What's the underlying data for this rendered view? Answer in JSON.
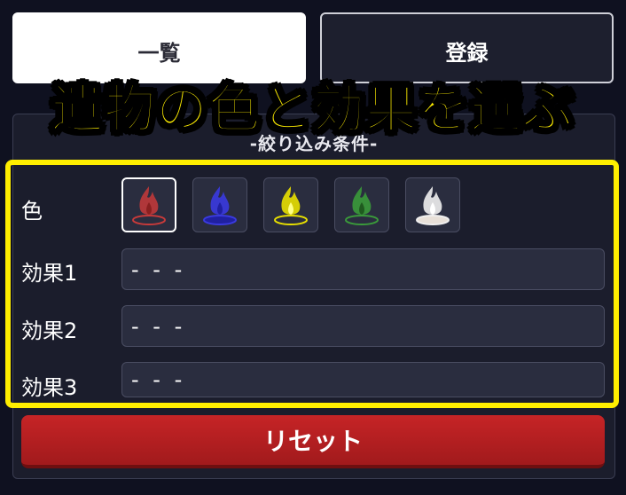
{
  "tabs": {
    "list_label": "一覧",
    "register_label": "登録"
  },
  "banner": {
    "text": "遺物の色と効果を選ぶ"
  },
  "filter": {
    "title": "-絞り込み条件-",
    "color_label": "色",
    "colors": [
      {
        "name": "red",
        "hex": "#c83a3a",
        "selected": true
      },
      {
        "name": "blue",
        "hex": "#3a3ae0",
        "selected": false
      },
      {
        "name": "yellow",
        "hex": "#e8e000",
        "selected": false
      },
      {
        "name": "green",
        "hex": "#3a9a3a",
        "selected": false
      },
      {
        "name": "white",
        "hex": "#f0f0f0",
        "selected": false
      }
    ],
    "effects": [
      {
        "label": "効果1",
        "value": "- - -"
      },
      {
        "label": "効果2",
        "value": "- - -"
      },
      {
        "label": "効果3",
        "value": "- - -"
      }
    ]
  },
  "reset_label": "リセット",
  "icons": [
    "flame-icon"
  ],
  "accent_colors": {
    "highlight": "#ffee00",
    "reset": "#c62426",
    "background": "#0f1120"
  }
}
